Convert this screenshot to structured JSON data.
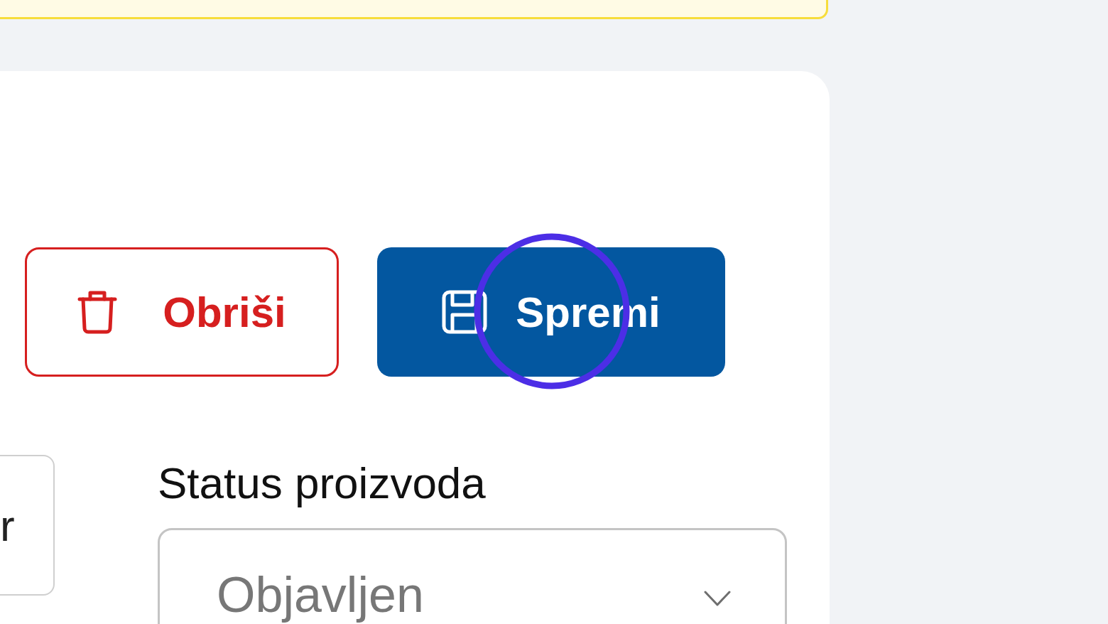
{
  "actions": [
    {
      "kind": "delete",
      "label": "Obriši",
      "highlighted": false
    },
    {
      "kind": "save",
      "label": "Spremi",
      "highlighted": true
    }
  ],
  "fields": [
    {
      "kind": "text",
      "value": "r"
    },
    {
      "kind": "select",
      "label": "Status proizvoda",
      "value": "Objavljen"
    }
  ]
}
